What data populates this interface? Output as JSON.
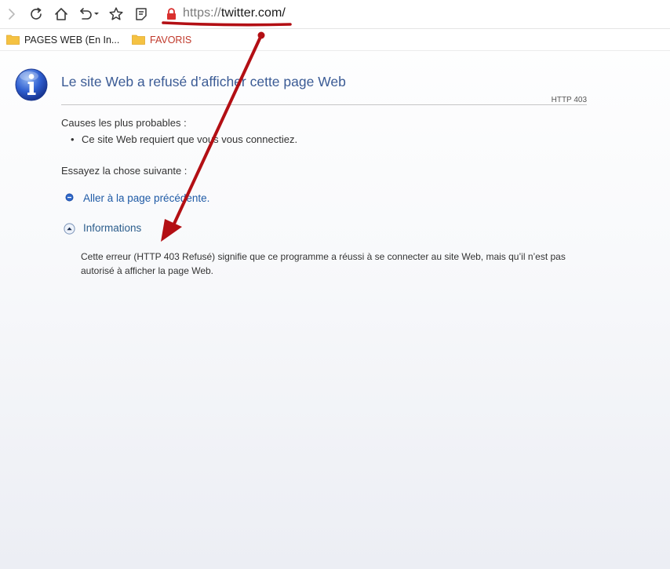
{
  "toolbar": {
    "buttons": [
      {
        "name": "forward-icon",
        "interactable": true
      },
      {
        "name": "refresh-icon",
        "interactable": true
      },
      {
        "name": "home-icon",
        "interactable": true
      },
      {
        "name": "undo-icon",
        "interactable": true
      },
      {
        "name": "favorite-star-icon",
        "interactable": true
      },
      {
        "name": "reading-list-icon",
        "interactable": true
      }
    ],
    "lock_icon": "lock-icon",
    "url_scheme": "https://",
    "url_host": "twitter.com/"
  },
  "favorites": [
    {
      "label": "PAGES WEB (En In...",
      "icon": "folder-icon"
    },
    {
      "label": "FAVORIS",
      "icon": "folder-icon"
    }
  ],
  "error": {
    "icon": "info-icon",
    "title": "Le site Web a refusé d’afficher cette page Web",
    "code": "HTTP 403",
    "causes_heading": "Causes les plus probables :",
    "causes": [
      "Ce site Web requiert que vous vous connectiez."
    ],
    "try_heading": "Essayez la chose suivante :",
    "back_link": "Aller à la page précédente.",
    "info_toggle": "Informations",
    "details": "Cette erreur (HTTP 403 Refusé) signifie que ce programme a réussi à se connecter au site Web, mais qu’il n’est pas autorisé à afficher la page Web."
  },
  "colors": {
    "annotation": "#b30f14",
    "title": "#3b5b95",
    "link": "#1f5aa6",
    "lock": "#d9302e",
    "folder": "#f5c242"
  }
}
